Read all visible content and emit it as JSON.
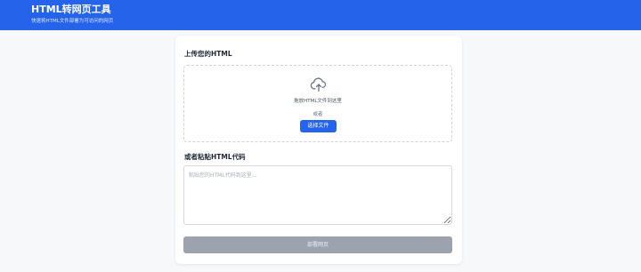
{
  "header": {
    "title": "HTML转网页工具",
    "subtitle": "快速将HTML文件部署为可访问的网页"
  },
  "upload": {
    "title": "上传您的HTML",
    "icon": "cloud-upload-icon",
    "drop_text": "拖放HTML文件到这里",
    "or_text": "或者",
    "choose_label": "选择文件"
  },
  "paste": {
    "title": "或者粘贴HTML代码",
    "placeholder": "粘贴您的HTML代码到这里...",
    "value": ""
  },
  "deploy": {
    "label": "部署网页"
  },
  "colors": {
    "header_bg": "#2563eb",
    "primary_button": "#2563eb",
    "disabled_button": "#9ca3af",
    "page_bg": "#f7f8fa"
  }
}
